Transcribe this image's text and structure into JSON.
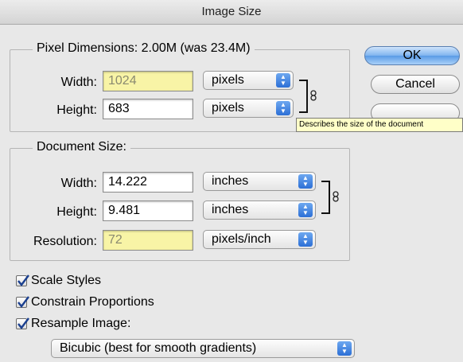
{
  "window": {
    "title": "Image Size"
  },
  "pixel_dimensions": {
    "legend": "Pixel Dimensions:  2.00M (was 23.4M)",
    "width": {
      "label": "Width:",
      "value": "1024",
      "unit": "pixels"
    },
    "height": {
      "label": "Height:",
      "value": "683",
      "unit": "pixels"
    }
  },
  "document_size": {
    "legend": "Document Size:",
    "width": {
      "label": "Width:",
      "value": "14.222",
      "unit": "inches"
    },
    "height": {
      "label": "Height:",
      "value": "9.481",
      "unit": "inches"
    },
    "resolution": {
      "label": "Resolution:",
      "value": "72",
      "unit": "pixels/inch"
    }
  },
  "buttons": {
    "ok": "OK",
    "cancel": "Cancel"
  },
  "tooltip": "Describes the size of the document",
  "options": {
    "scale_styles": "Scale Styles",
    "constrain_proportions": "Constrain Proportions",
    "resample_image": "Resample Image:",
    "resample_method": "Bicubic (best for smooth gradients)"
  },
  "colors": {
    "highlight_field": "#f8f4a6",
    "default_button": "#7fb4ef",
    "select_arrows": "#2c6fd6"
  }
}
